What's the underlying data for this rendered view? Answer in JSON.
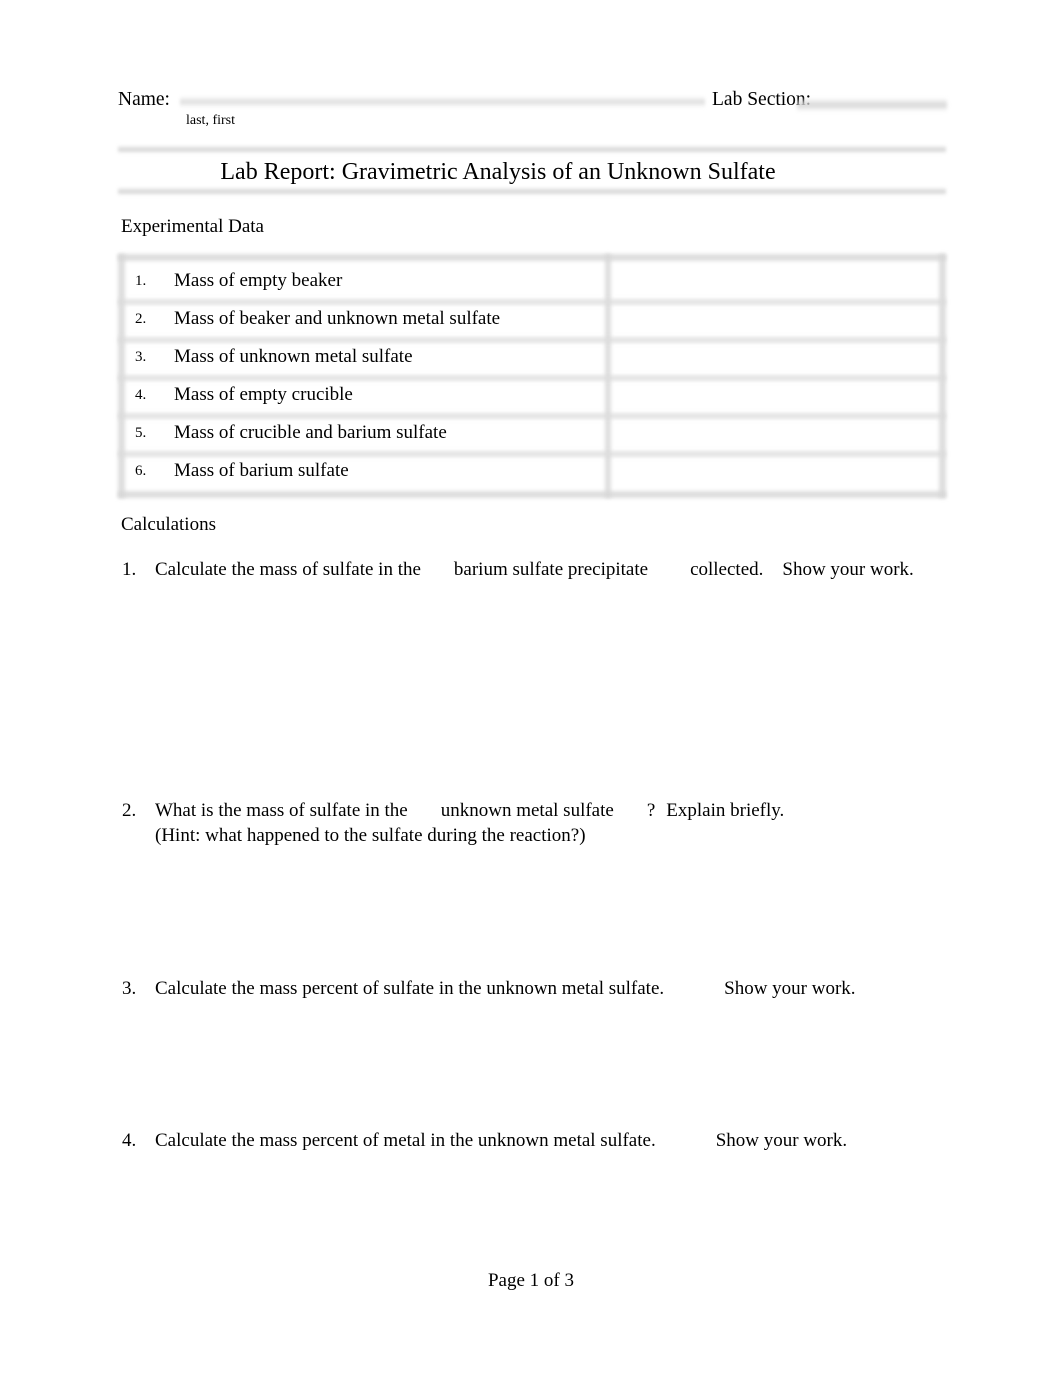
{
  "header": {
    "name_label": "Name:",
    "name_value": "",
    "name_sublabel": "last, first",
    "lab_section_label": "Lab Section:",
    "lab_section_value": ""
  },
  "title": "Lab Report: Gravimetric Analysis of an Unknown Sulfate",
  "sections": {
    "experimental_data_heading": "Experimental Data",
    "calculations_heading": "Calculations"
  },
  "experimental_table": {
    "rows": [
      {
        "number": "1.",
        "label": "Mass of empty beaker",
        "value": ""
      },
      {
        "number": "2.",
        "label": "Mass of beaker and unknown metal sulfate",
        "value": ""
      },
      {
        "number": "3.",
        "label": "Mass of unknown metal sulfate",
        "value": ""
      },
      {
        "number": "4.",
        "label": "Mass of empty crucible",
        "value": ""
      },
      {
        "number": "5.",
        "label": "Mass of crucible and barium sulfate",
        "value": ""
      },
      {
        "number": "6.",
        "label": "Mass of barium sulfate",
        "value": ""
      }
    ]
  },
  "questions": [
    {
      "number": "1.",
      "seg1": "Calculate the mass of sulfate in the",
      "seg2": "barium sulfate precipitate",
      "seg3": "collected.",
      "seg4": "Show your work.",
      "hint": ""
    },
    {
      "number": "2.",
      "seg1": "What is the mass of sulfate in the",
      "seg2": "unknown metal sulfate",
      "seg3": "?",
      "seg4": "Explain briefly.",
      "hint": "(Hint: what happened to the sulfate during the reaction?)"
    },
    {
      "number": "3.",
      "seg1": "Calculate the mass percent of sulfate in the unknown metal sulfate.",
      "seg2": "",
      "seg3": "",
      "seg4": "Show your work.",
      "hint": ""
    },
    {
      "number": "4.",
      "seg1": "Calculate the mass percent of metal in the unknown metal sulfate.",
      "seg2": "",
      "seg3": "",
      "seg4": "Show your work.",
      "hint": ""
    }
  ],
  "footer": {
    "page_text": "Page 1 of 3"
  }
}
